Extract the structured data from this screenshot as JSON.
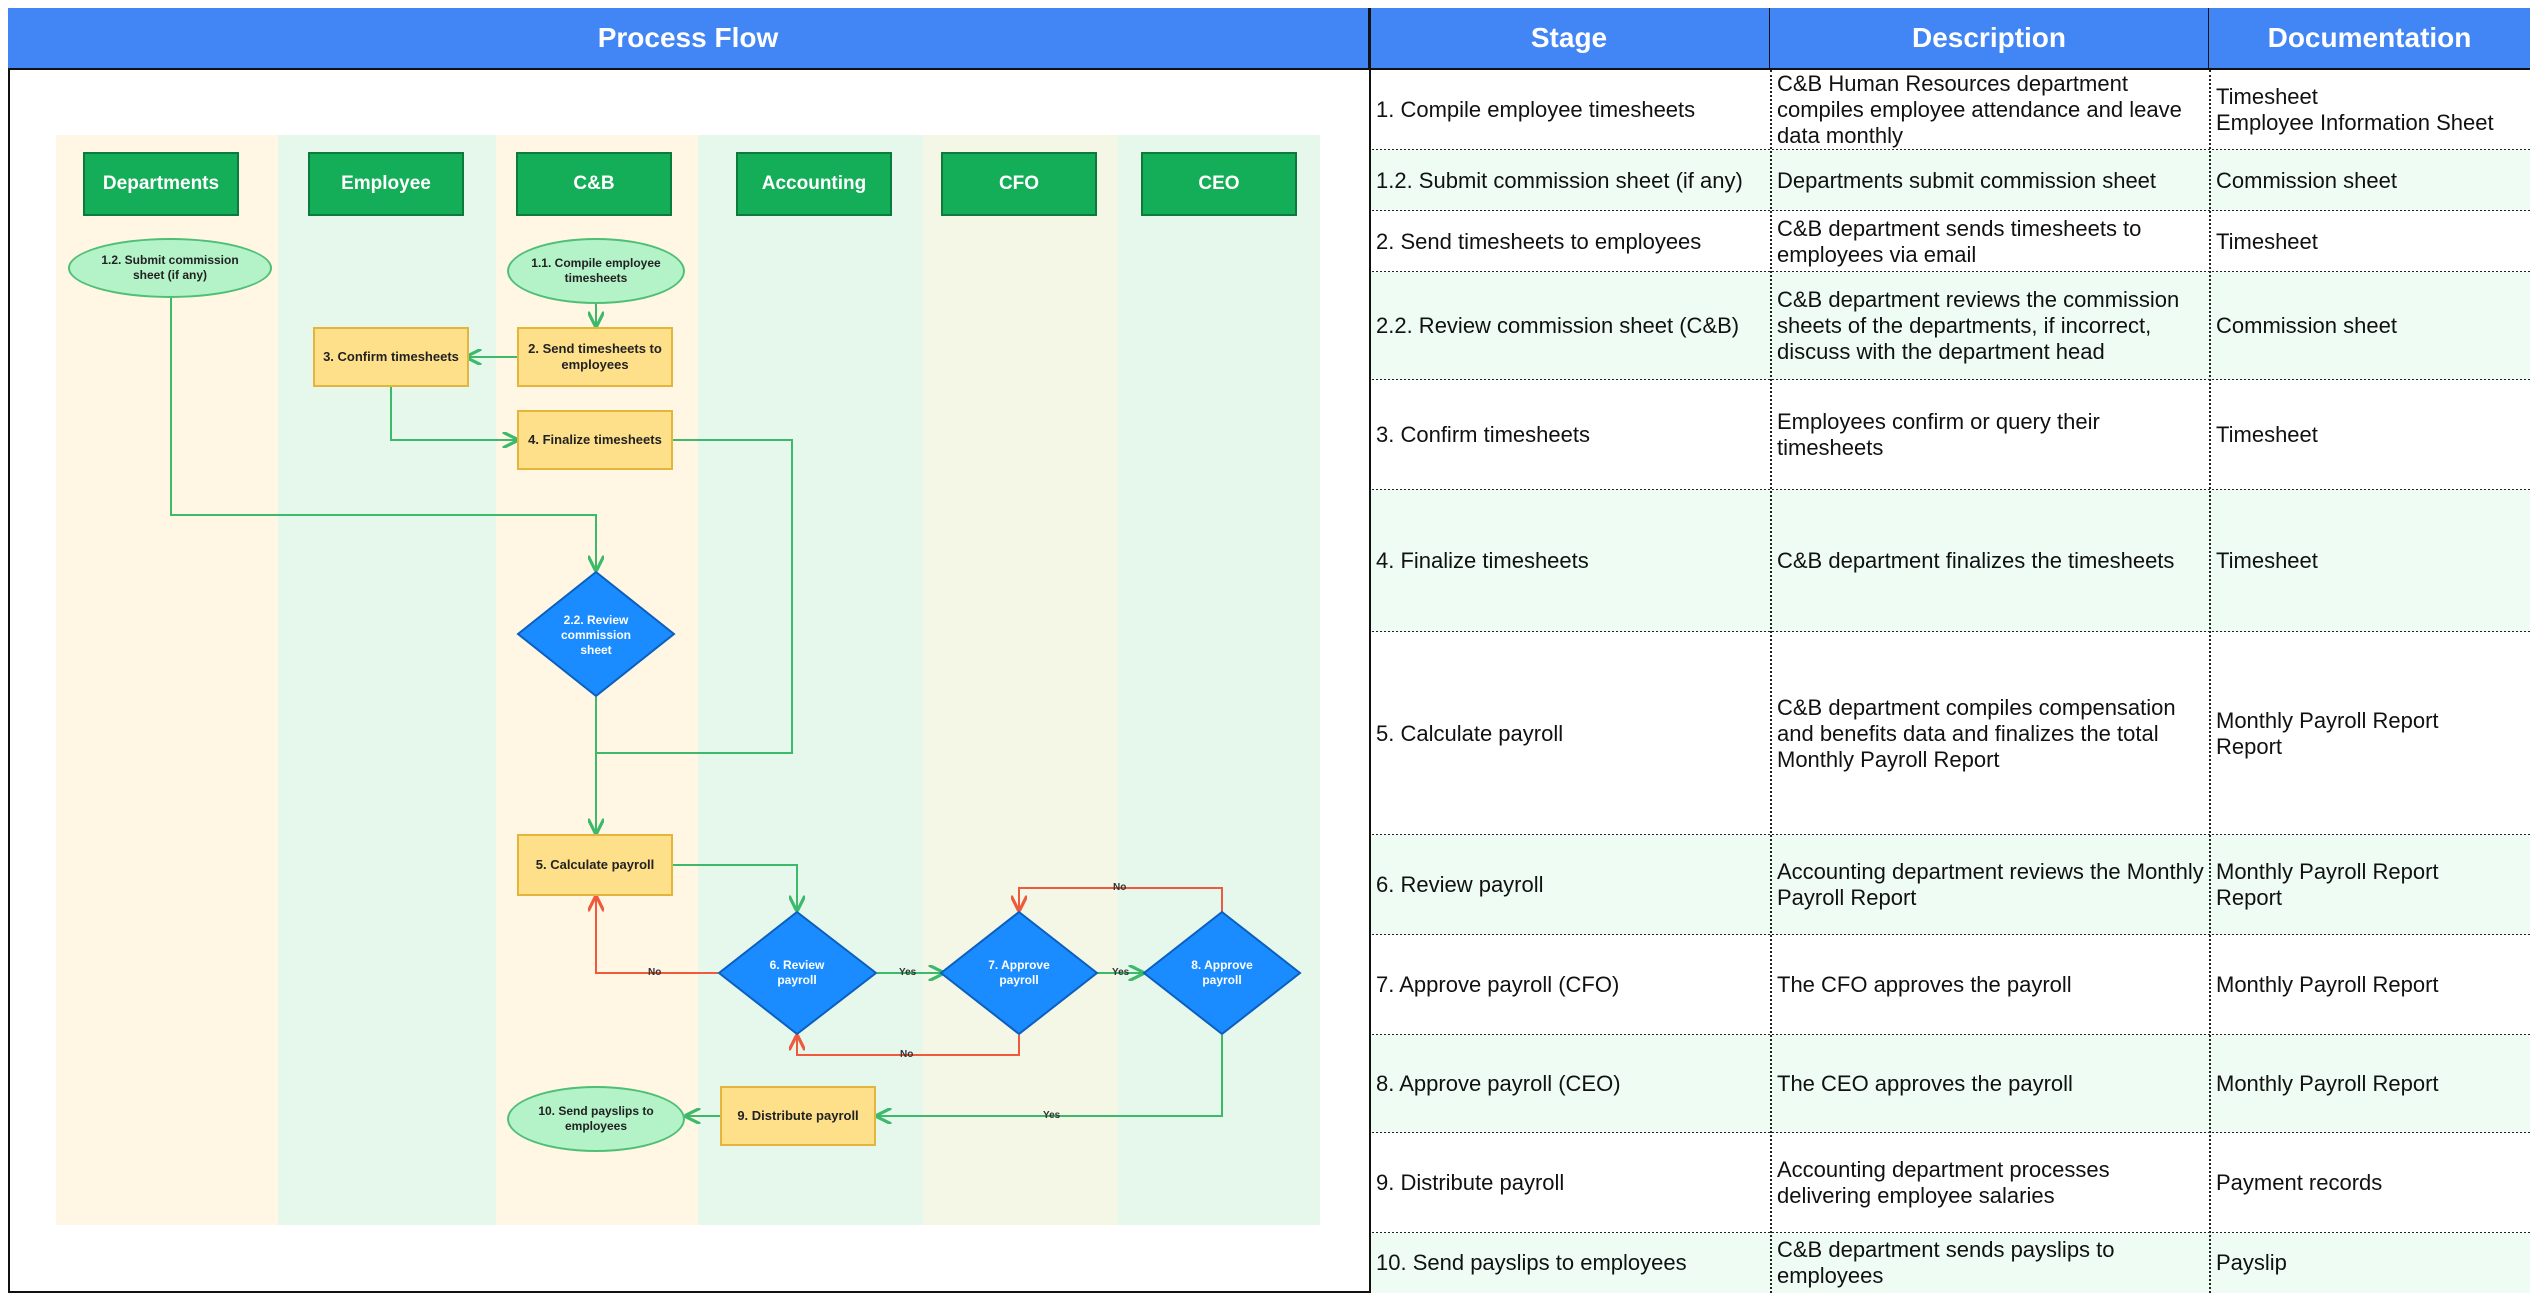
{
  "headers": {
    "process_flow": "Process Flow",
    "stage": "Stage",
    "description": "Description",
    "documentation": "Documentation"
  },
  "lanes": [
    "Departments",
    "Employee",
    "C&B",
    "Accounting",
    "CFO",
    "CEO"
  ],
  "nodes": {
    "submit_commission": "1.2. Submit commission sheet (if any)",
    "compile_timesheets": "1.1. Compile employee timesheets",
    "send_timesheets": "2. Send timesheets to employees",
    "confirm_timesheets": "3. Confirm timesheets",
    "finalize_timesheets": "4. Finalize timesheets",
    "review_commission": "2.2. Review commission sheet",
    "calculate_payroll": "5. Calculate payroll",
    "review_payroll": "6. Review payroll",
    "approve_cfo": "7. Approve payroll",
    "approve_ceo": "8. Approve payroll",
    "distribute_payroll": "9. Distribute payroll",
    "send_payslips": "10. Send payslips to employees"
  },
  "edge_labels": {
    "no_review": "No",
    "yes_review": "Yes",
    "no_cfo": "No",
    "yes_cfo": "Yes",
    "no_ceo": "No",
    "yes_ceo": "Yes"
  },
  "colors": {
    "header_blue": "#4285f4",
    "lane_green": "#14ad58",
    "decision_blue": "#1a8cff",
    "process_yellow": "#ffe08a",
    "terminal_green": "#b4f2c8",
    "yes_arrow": "#3cb96a",
    "no_arrow": "#f05a3c"
  },
  "table": [
    {
      "stage": "1. Compile employee timesheets",
      "description": "C&B Human Resources department compiles employee attendance and leave data monthly",
      "documentation": "Timesheet\nEmployee Information Sheet"
    },
    {
      "stage": "1.2. Submit commission sheet (if any)",
      "description": "Departments submit commission sheet",
      "documentation": "Commission sheet"
    },
    {
      "stage": "2. Send timesheets to employees",
      "description": "C&B department sends timesheets to employees via email",
      "documentation": "Timesheet"
    },
    {
      "stage": "2.2. Review commission sheet (C&B)",
      "description": "C&B department reviews the commission sheets of the departments, if incorrect, discuss with the department head",
      "documentation": "Commission sheet"
    },
    {
      "stage": "3. Confirm timesheets",
      "description": "Employees confirm or query their timesheets",
      "documentation": "Timesheet"
    },
    {
      "stage": "4. Finalize timesheets",
      "description": "C&B department finalizes the timesheets",
      "documentation": "Timesheet"
    },
    {
      "stage": "5. Calculate payroll",
      "description": "C&B department compiles compensation and benefits data and finalizes the total Monthly Payroll Report",
      "documentation": "Monthly Payroll Report\nReport"
    },
    {
      "stage": "6. Review payroll",
      "description": "Accounting department reviews the Monthly Payroll Report",
      "documentation": "Monthly Payroll Report\nReport"
    },
    {
      "stage": "7. Approve payroll (CFO)",
      "description": "The CFO approves the payroll",
      "documentation": "Monthly Payroll Report"
    },
    {
      "stage": "8. Approve payroll (CEO)",
      "description": "The CEO approves the payroll",
      "documentation": "Monthly Payroll Report"
    },
    {
      "stage": "9. Distribute payroll",
      "description": "Accounting department processes delivering employee salaries",
      "documentation": "Payment records"
    },
    {
      "stage": "10. Send payslips to employees",
      "description": "C&B department sends payslips to employees",
      "documentation": "Payslip"
    }
  ]
}
